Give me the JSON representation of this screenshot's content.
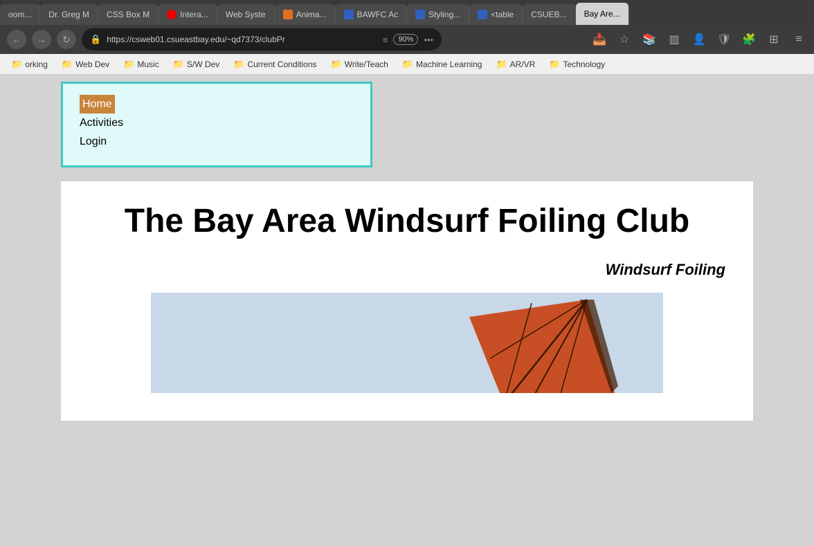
{
  "browser": {
    "tabs": [
      {
        "id": "tab-1",
        "label": "oom...",
        "favicon_type": "default",
        "active": false
      },
      {
        "id": "tab-2",
        "label": "Dr. Greg M",
        "favicon_type": "default",
        "active": false
      },
      {
        "id": "tab-3",
        "label": "CSS Box M",
        "favicon_type": "default",
        "active": false
      },
      {
        "id": "tab-4",
        "label": "Intera...",
        "favicon_type": "red",
        "active": false
      },
      {
        "id": "tab-5",
        "label": "Web Syste",
        "favicon_type": "default",
        "active": false
      },
      {
        "id": "tab-6",
        "label": "Anima...",
        "favicon_type": "orange",
        "active": false
      },
      {
        "id": "tab-7",
        "label": "BAWFC Ac",
        "favicon_type": "blue-bird",
        "active": false
      },
      {
        "id": "tab-8",
        "label": "Styling...",
        "favicon_type": "blue-bird",
        "active": false
      },
      {
        "id": "tab-9",
        "label": "<table",
        "favicon_type": "blue-bird",
        "active": false
      },
      {
        "id": "tab-10",
        "label": "CSUEB...",
        "favicon_type": "default",
        "active": false
      },
      {
        "id": "tab-11",
        "label": "Bay Are...",
        "favicon_type": "default",
        "active": true
      }
    ],
    "url": "https://csweb01.csueastbay.edu/~qd7373/clubPr",
    "zoom": "90%"
  },
  "bookmarks": [
    {
      "label": "orking"
    },
    {
      "label": "Web Dev"
    },
    {
      "label": "Music"
    },
    {
      "label": "S/W Dev"
    },
    {
      "label": "Current Conditions"
    },
    {
      "label": "Write/Teach"
    },
    {
      "label": "Machine Learning"
    },
    {
      "label": "AR/VR"
    },
    {
      "label": "Technology"
    }
  ],
  "nav": {
    "home": "Home",
    "activities": "Activities",
    "login": "Login"
  },
  "page": {
    "title": "The Bay Area Windsurf Foiling Club",
    "subtitle": "Windsurf Foiling"
  }
}
